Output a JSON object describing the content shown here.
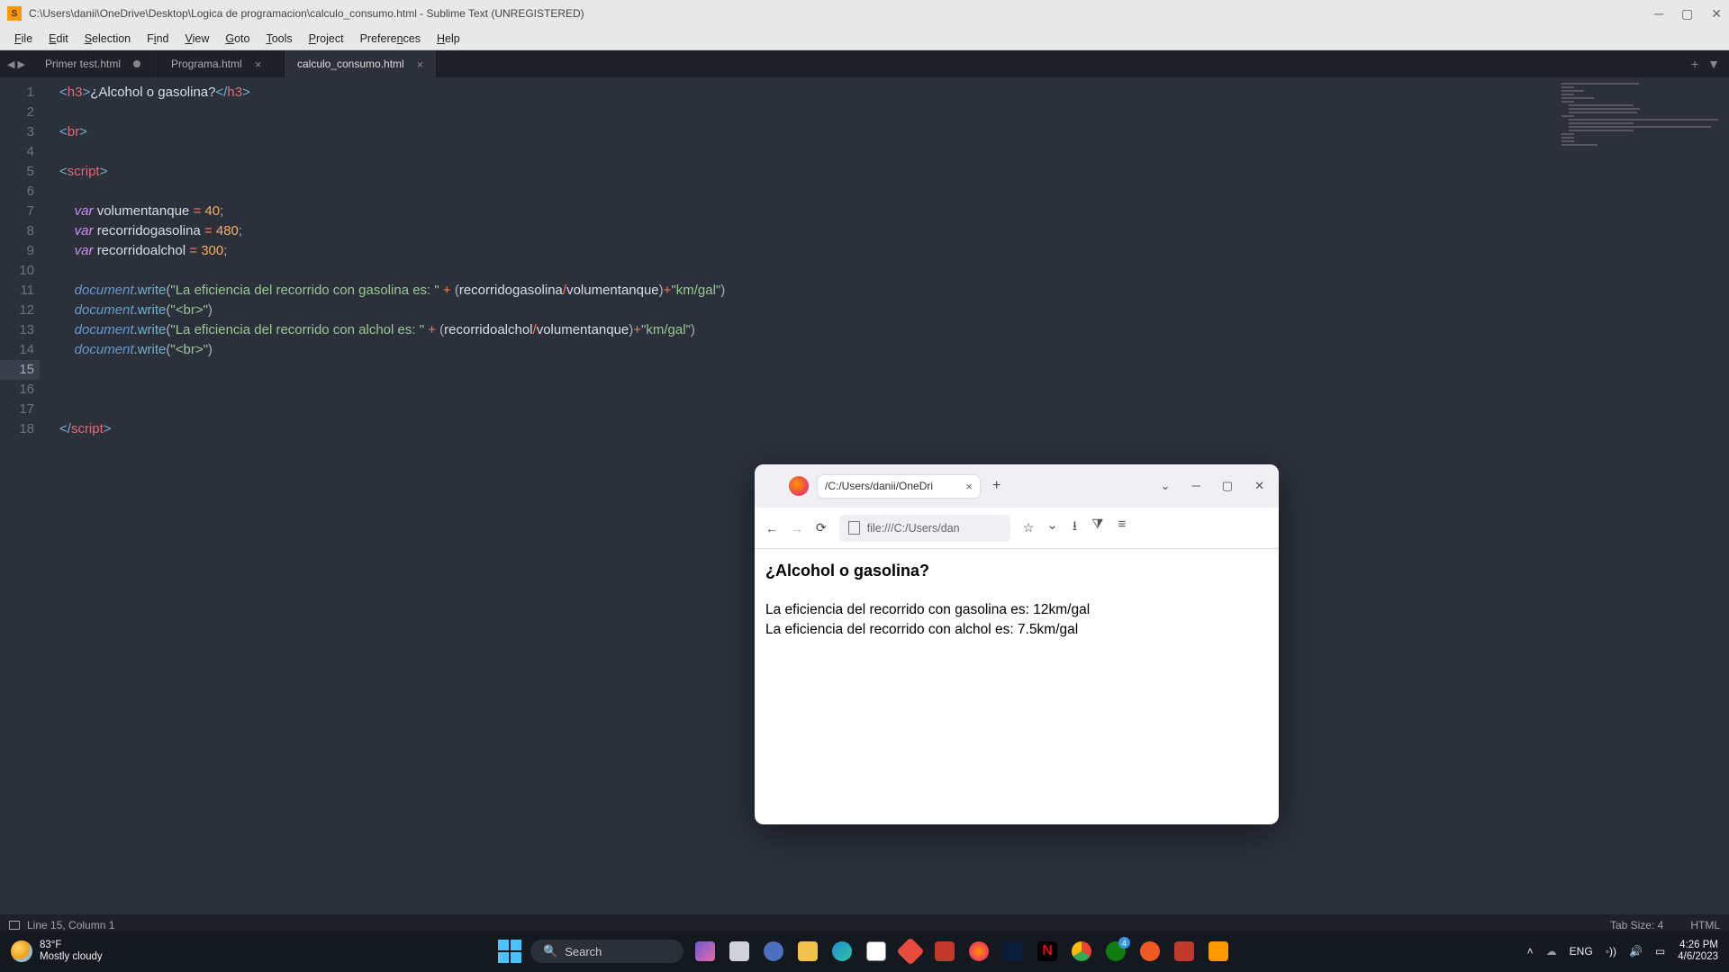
{
  "titlebar": {
    "path": "C:\\Users\\danii\\OneDrive\\Desktop\\Logica de programacion\\calculo_consumo.html - Sublime Text (UNREGISTERED)"
  },
  "menu": {
    "items": [
      "File",
      "Edit",
      "Selection",
      "Find",
      "View",
      "Goto",
      "Tools",
      "Project",
      "Preferences",
      "Help"
    ]
  },
  "tabs": {
    "t0": "Primer test.html",
    "t1": "Programa.html",
    "t2": "calculo_consumo.html"
  },
  "code": {
    "lines_count": 18,
    "active_line": 15,
    "l1_text": "¿Alcohol o gasolina?",
    "l7_var": "volumentanque",
    "l7_val": "40",
    "l8_var": "recorridogasolina",
    "l8_val": "480",
    "l9_var": "recorridoalchol",
    "l9_val": "300",
    "l11_str": "\"La eficiencia del recorrido con gasolina es: \"",
    "l11_expr_a": "recorridogasolina",
    "l11_expr_b": "volumentanque",
    "l11_tail": "\"km/gal\"",
    "l12_str": "\"<br>\"",
    "l13_str": "\"La eficiencia del recorrido con alchol es: \"",
    "l13_expr_a": "recorridoalchol",
    "l13_expr_b": "volumentanque",
    "l13_tail": "\"km/gal\"",
    "l14_str": "\"<br>\""
  },
  "statusbar": {
    "pos": "Line 15, Column 1",
    "tab": "Tab Size: 4",
    "lang": "HTML"
  },
  "browser": {
    "tab_title": "/C:/Users/danii/OneDri",
    "url": "file:///C:/Users/dan",
    "heading": "¿Alcohol o gasolina?",
    "line1": "La eficiencia del recorrido con gasolina es: 12km/gal",
    "line2": "La eficiencia del recorrido con alchol es: 7.5km/gal"
  },
  "taskbar": {
    "temp": "83°F",
    "cond": "Mostly cloudy",
    "search": "Search",
    "lang": "ENG",
    "time": "4:26 PM",
    "date": "4/6/2023",
    "xbox_badge": "4"
  }
}
